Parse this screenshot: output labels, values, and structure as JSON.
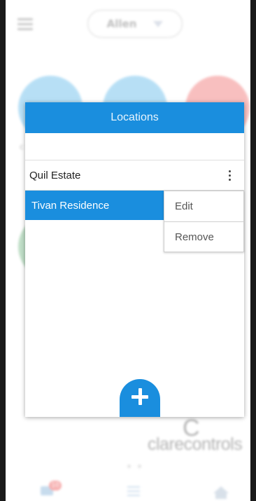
{
  "header": {
    "user_name": "Allen"
  },
  "background_tiles": {
    "partial_label": "c"
  },
  "modal": {
    "title": "Locations",
    "search_value": "",
    "locations": [
      {
        "name": "Quil Estate",
        "selected": false
      },
      {
        "name": "Tivan Residence",
        "selected": true
      }
    ],
    "context_menu": {
      "edit_label": "Edit",
      "remove_label": "Remove"
    }
  },
  "brand": {
    "logo_glyph": "C",
    "name": "clarecontrols"
  },
  "pager": {
    "pages": 2,
    "current": 1
  },
  "tabbar": {
    "messages_badge": "10",
    "icons": [
      "chat-icon",
      "list-icon",
      "home-icon"
    ]
  },
  "colors": {
    "accent": "#1a8ede",
    "badge": "#f07070"
  }
}
